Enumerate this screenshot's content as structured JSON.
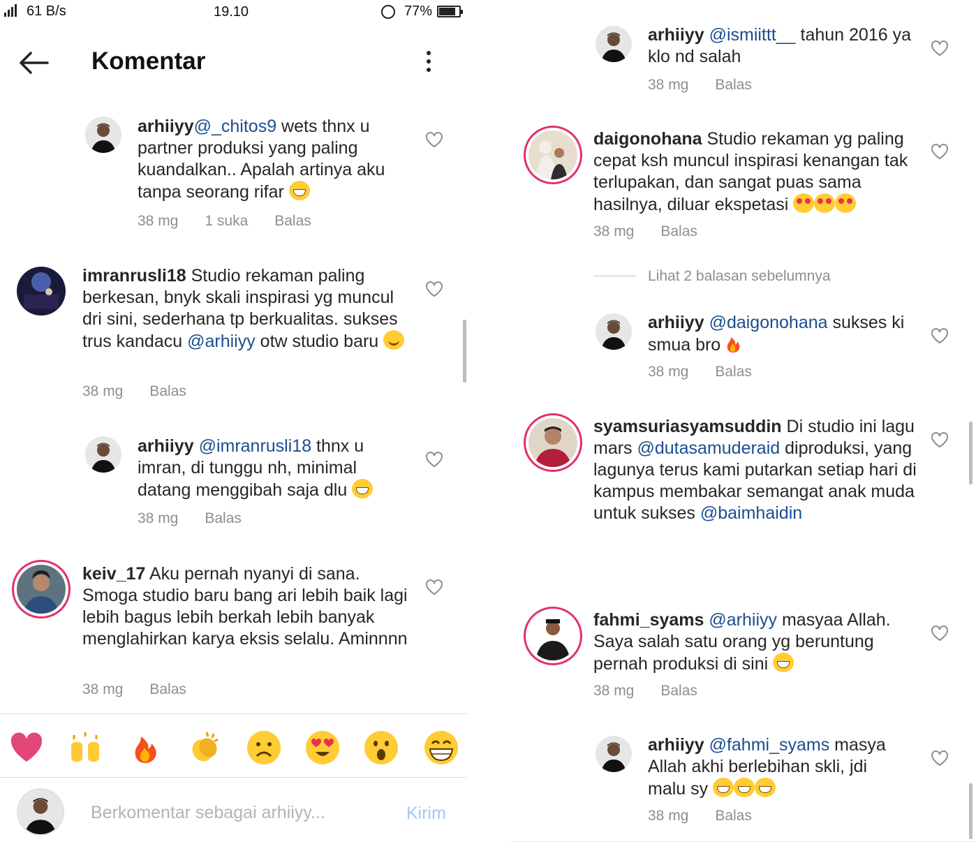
{
  "status": {
    "net": "61 B/s",
    "time": "19.10",
    "battery": "77%",
    "sig": "4G"
  },
  "header": {
    "title": "Komentar"
  },
  "left": [
    {
      "user": "arhiiyy",
      "mention": "@_chitos9",
      "text_lines": [
        " wets thnx u",
        "partner produksi yang paling",
        "kuandalkan.. Apalah artinya aku",
        "tanpa seorang rifar "
      ],
      "emoji": "grin",
      "time": "38 mg",
      "likes": "1 suka",
      "reply": "Balas"
    },
    {
      "user": "imranrusli18",
      "text_a": " Studio rekaman paling berkesan, bnyk skali inspirasi yg muncul dri sini, sederhana tp berkualitas. sukses trus kandacu ",
      "mention": "@arhiiyy",
      "text_b": " otw studio baru ",
      "emoji": "smile",
      "time": "38 mg",
      "reply": "Balas"
    },
    {
      "user": "arhiiyy",
      "mention": "@imranrusli18",
      "text_a": " thnx u imran,  di tunggu nh,  minimal datang menggibah saja dlu ",
      "emoji": "grin",
      "time": "38 mg",
      "reply": "Balas"
    },
    {
      "user": "keiv_17",
      "text_a": " Aku pernah nyanyi di sana. Smoga studio baru bang ari lebih baik lagi lebih bagus lebih berkah lebih banyak menglahirkan karya eksis selalu. Aminnnn",
      "time": "38 mg",
      "reply": "Balas"
    }
  ],
  "right": [
    {
      "user": "arhiiyy",
      "mention": "@ismiittt__",
      "text_a": " tahun 2016 ya klo nd salah",
      "time": "38 mg",
      "reply": "Balas"
    },
    {
      "user": "daigonohana",
      "text_a": " Studio rekaman yg paling cepat ksh muncul inspirasi kenangan tak terlupakan, dan sangat puas sama hasilnya, diluar ekspetasi ",
      "emoji": "heart-eyes x3",
      "time": "38 mg",
      "reply": "Balas"
    },
    {
      "view_prev": "Lihat 2 balasan sebelumnya"
    },
    {
      "user": "arhiiyy",
      "mention": "@daigonohana",
      "text_a": " sukses ki smua bro ",
      "emoji": "fire",
      "time": "38 mg",
      "reply": "Balas"
    },
    {
      "user": "syamsuriasyamsuddin",
      "text_a": " Di studio ini lagu mars ",
      "mention": "@dutasamuderaid",
      "text_b": " diproduksi, yang lagunya terus kami putarkan setiap hari di kampus membakar semangat anak muda untuk sukses ",
      "mention2": "@baimhaidin"
    },
    {
      "user": "fahmi_syams",
      "mention": "@arhiiyy",
      "text_a": " masyaa Allah. Saya salah satu orang yg beruntung pernah produksi di sini ",
      "emoji": "grin",
      "time": "38 mg",
      "reply": "Balas"
    },
    {
      "user": "arhiiyy",
      "mention": "@fahmi_syams",
      "text_a": " masya Allah akhi berlebihan skli,  jdi malu sy ",
      "emoji": "grin x3",
      "time": "38 mg",
      "reply": "Balas"
    }
  ],
  "reactions": [
    "heart",
    "raised-hands",
    "fire",
    "clapping-hands",
    "sad-face",
    "heart-eyes-face",
    "surprised-face",
    "grin-face"
  ],
  "composer": {
    "placeholder": "Berkomentar sebagai arhiiyy...",
    "send": "Kirim"
  },
  "colors": {
    "mention": "#1b4d8f",
    "meta": "#8e8e8e",
    "story_ring": "#e1306c",
    "send": "#9ecbf5"
  }
}
